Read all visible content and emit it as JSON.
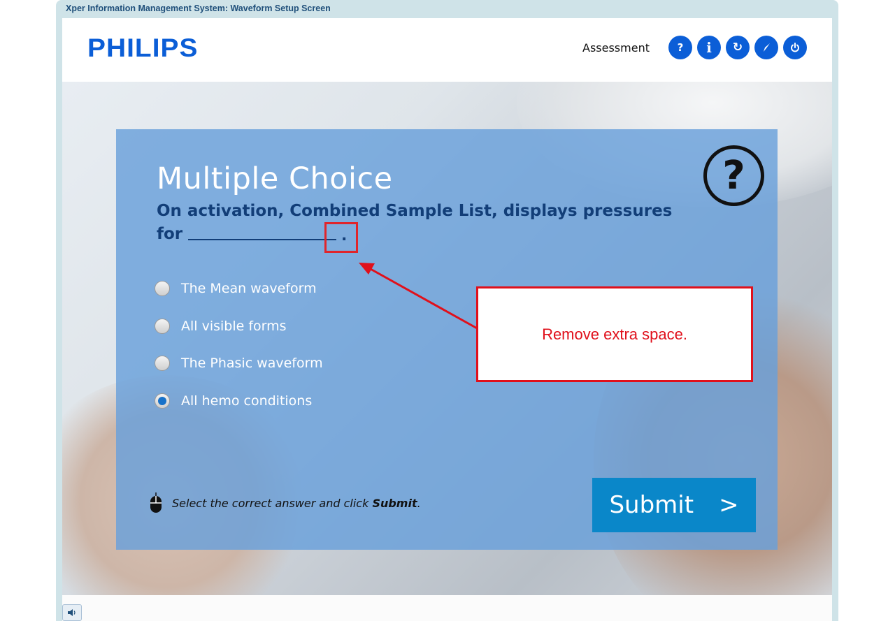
{
  "window": {
    "title": "Xper Information Management System: Waveform Setup Screen"
  },
  "header": {
    "brand": "PHILIPS",
    "section_label": "Assessment",
    "buttons": [
      {
        "icon": "help-icon",
        "glyph": "?"
      },
      {
        "icon": "info-icon",
        "glyph": "i"
      },
      {
        "icon": "refresh-icon",
        "glyph": "↻"
      },
      {
        "icon": "compass-icon",
        "glyph": "⟋"
      },
      {
        "icon": "power-icon",
        "glyph": "⏻"
      }
    ]
  },
  "question": {
    "type": "Multiple Choice",
    "text_line1": "On activation, Combined Sample List, displays pressures",
    "text_line2": "for",
    "period": "."
  },
  "options": [
    {
      "label": "The Mean waveform",
      "selected": false
    },
    {
      "label": "All visible forms",
      "selected": false
    },
    {
      "label": "The Phasic waveform",
      "selected": false
    },
    {
      "label": "All hemo conditions",
      "selected": true
    }
  ],
  "instruction": {
    "prefix": "Select the correct answer and click ",
    "bold": "Submit",
    "suffix": "."
  },
  "submit": {
    "label": "Submit",
    "chevron": ">"
  },
  "annotation": {
    "text": "Remove extra space.",
    "color": "#e0101b"
  },
  "colors": {
    "brand": "#0b5ed7",
    "panel": "#69a0da",
    "submit": "#0a87c9",
    "question_text": "#123e78"
  }
}
